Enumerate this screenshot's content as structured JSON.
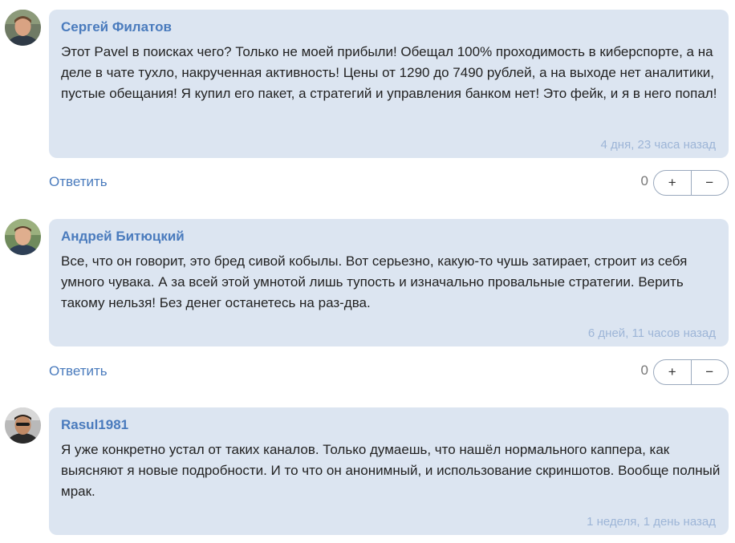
{
  "comments": [
    {
      "author": "Сергей Филатов",
      "text": "Этот Pavel в поисках чего? Только не моей прибыли! Обещал 100% проходимость в киберспорте, а на деле в чате тухло, накрученная активность! Цены от 1290 до 7490 рублей, а на выходе нет аналитики, пустые обещания! Я купил его пакет, а стратегий и управления банком нет! Это фейк, и я в него попал!",
      "time": "4 дня, 23 часа назад",
      "reply_label": "Ответить",
      "score": "0",
      "upvote_label": "+",
      "downvote_label": "−"
    },
    {
      "author": "Андрей Битюцкий",
      "text": "Все, что он говорит, это бред сивой кобылы. Вот серьезно, какую-то чушь затирает, строит из себя умного чувака. А за всей этой умнотой лишь тупость и изначально провальные стратегии. Верить такому нельзя! Без денег останетесь на раз-два.",
      "time": "6 дней, 11 часов назад",
      "reply_label": "Ответить",
      "score": "0",
      "upvote_label": "+",
      "downvote_label": "−"
    },
    {
      "author": "Rasul1981",
      "text": "Я уже конкретно устал от таких каналов. Только думаешь, что нашёл нормального каппера, как выясняют я новые подробности. И то что он анонимный, и использование скриншотов. Вообще полный мрак.",
      "time": "1 неделя, 1 день назад"
    }
  ],
  "colors": {
    "bubble_bg": "#dce5f1",
    "author": "#4a7bbd",
    "timestamp": "#9db5d7",
    "reply_link": "#4a7bbd"
  }
}
